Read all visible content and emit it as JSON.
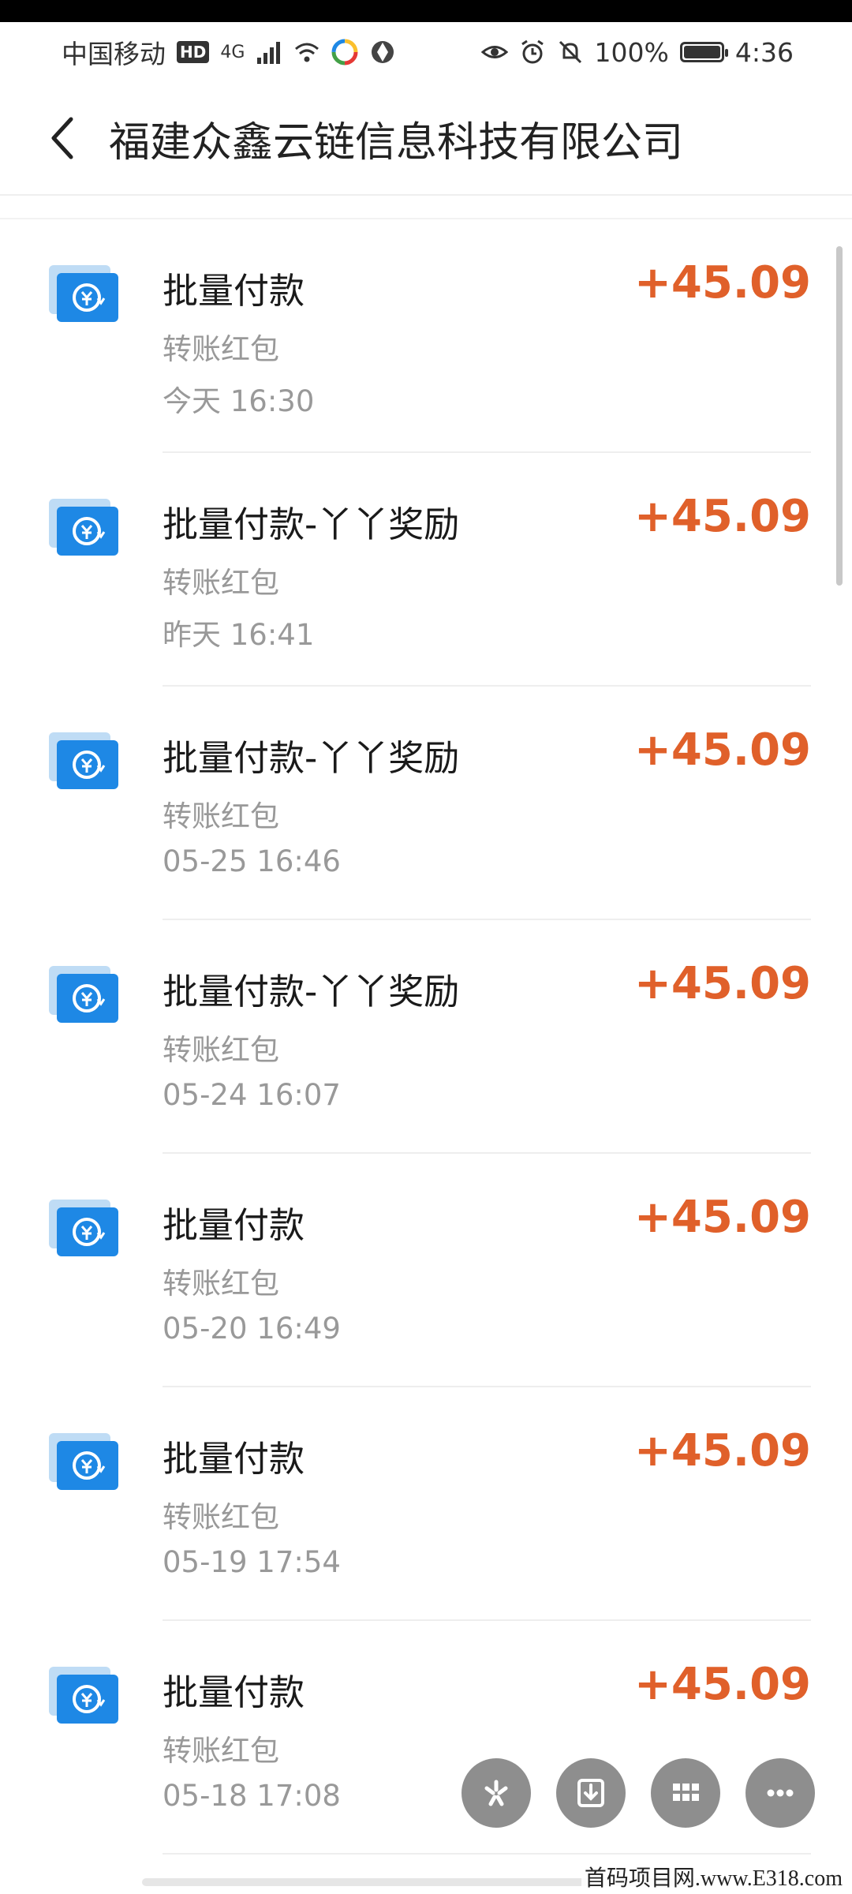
{
  "status_bar": {
    "carrier": "中国移动",
    "hd": "HD",
    "network": "4G",
    "battery_percent": "100%",
    "time": "4:36",
    "battery_level": 1.0
  },
  "header": {
    "title": "福建众鑫云链信息科技有限公司"
  },
  "transactions": [
    {
      "name": "批量付款",
      "type": "转账红包",
      "time": "今天  16:30",
      "amount": "+45.09"
    },
    {
      "name": "批量付款-丫丫奖励",
      "type": "转账红包",
      "time": "昨天  16:41",
      "amount": "+45.09"
    },
    {
      "name": "批量付款-丫丫奖励",
      "type": "转账红包",
      "time": "05-25  16:46",
      "amount": "+45.09"
    },
    {
      "name": "批量付款-丫丫奖励",
      "type": "转账红包",
      "time": "05-24  16:07",
      "amount": "+45.09"
    },
    {
      "name": "批量付款",
      "type": "转账红包",
      "time": "05-20  16:49",
      "amount": "+45.09"
    },
    {
      "name": "批量付款",
      "type": "转账红包",
      "time": "05-19  17:54",
      "amount": "+45.09"
    },
    {
      "name": "批量付款",
      "type": "转账红包",
      "time": "05-18  17:08",
      "amount": "+45.09"
    }
  ],
  "floating_buttons": [
    "sparkle-icon",
    "download-icon",
    "grid-icon",
    "more-icon"
  ],
  "watermark": "首码项目网.www.E318.com",
  "colors": {
    "amount": "#e0602a",
    "icon_blue": "#1e88e5",
    "secondary_text": "#999999"
  }
}
